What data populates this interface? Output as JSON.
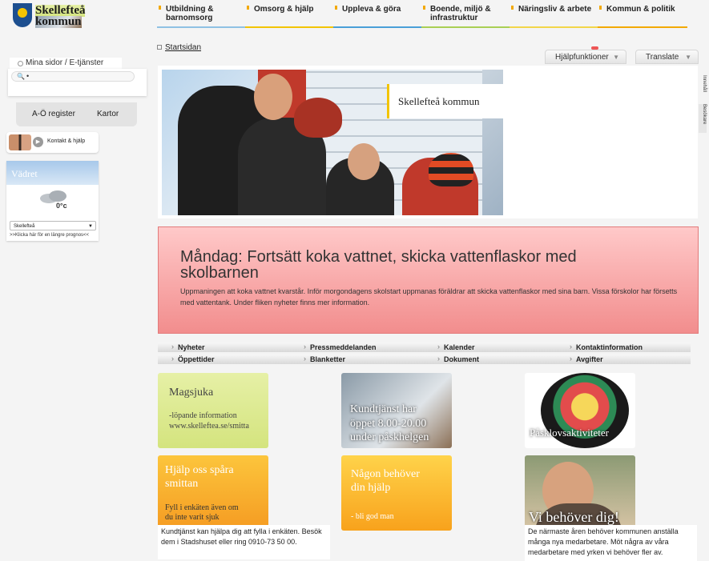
{
  "brand": {
    "line1": "Skellefteå",
    "line2": "kommun"
  },
  "nav": [
    {
      "label1": "Utbildning &",
      "label2": "barnomsorg",
      "color": "#8fc1e3"
    },
    {
      "label1": "Omsorg & hjälp",
      "label2": "",
      "color": "#f2c400"
    },
    {
      "label1": "Uppleva & göra",
      "label2": "",
      "color": "#4a9fd8"
    },
    {
      "label1": "Boende, miljö &",
      "label2": "infrastruktur",
      "color": "#a9cf54"
    },
    {
      "label1": "Näringsliv & arbete",
      "label2": "",
      "color": "#f2d64a"
    },
    {
      "label1": "Kommun & politik",
      "label2": "",
      "color": "#f2a900"
    }
  ],
  "breadcrumb": "Startsidan",
  "tools": {
    "help": "Hjälpfunktioner",
    "translate": "Translate"
  },
  "left": {
    "mina": "Mina sidor / E-tjänster",
    "search_value": "•",
    "az": "A-Ö register",
    "maps": "Kartor",
    "contact": "Kontakt & hjälp",
    "weather": {
      "title": "Vädret",
      "temp": "0°c",
      "city": "Skellefteå",
      "more": ">>Klicka här för en längre prognos<<"
    }
  },
  "side_tabs": [
    "Innehåll",
    "Besökare"
  ],
  "hero": {
    "title": "Skellefteå kommun"
  },
  "alert": {
    "headline": "Måndag: Fortsätt koka vattnet, skicka vattenflaskor med skolbarnen",
    "body": "Uppmaningen att koka vattnet kvarstår. Inför morgondagens skolstart uppmanas föräldrar att skicka vattenflaskor med sina barn. Vissa förskolor har försetts med vattentank. Under fliken nyheter finns mer information.",
    "color": "#f28d8d"
  },
  "quick_links": {
    "row1": [
      "Nyheter",
      "Pressmeddelanden",
      "Kalender",
      "Kontaktinformation"
    ],
    "row2": [
      "Öppettider",
      "Blanketter",
      "Dokument",
      "Avgifter"
    ]
  },
  "tiles": {
    "t1": {
      "title": "Magsjuka",
      "sub1": "-löpande information",
      "sub2": "www.skelleftea.se/smitta"
    },
    "t2": {
      "line1": "Kundtjänst har",
      "line2": "öppet 8.00-20.00",
      "line3": "under påskhelgen"
    },
    "t3": {
      "title": "Påsklovsaktiviteter"
    },
    "t4": {
      "line1": "Hjälp oss spåra",
      "line2": "smittan",
      "sub1": "Fyll i enkäten även om",
      "sub2": "du inte varit sjuk"
    },
    "t5": {
      "line1": "Någon behöver",
      "line2": "din hjälp",
      "sub": "- bli god man"
    },
    "t6": {
      "title": "Vi behöver dig!"
    }
  },
  "desc": {
    "d1": "Kundtjänst kan hjälpa dig att fylla i enkäten. Besök dem i Stadshuset eller ring 0910-73 50 00.",
    "d2": "De närmaste åren behöver kommunen anställa många nya medarbetare. Möt några av våra medarbetare med yrken vi behöver fler av."
  }
}
